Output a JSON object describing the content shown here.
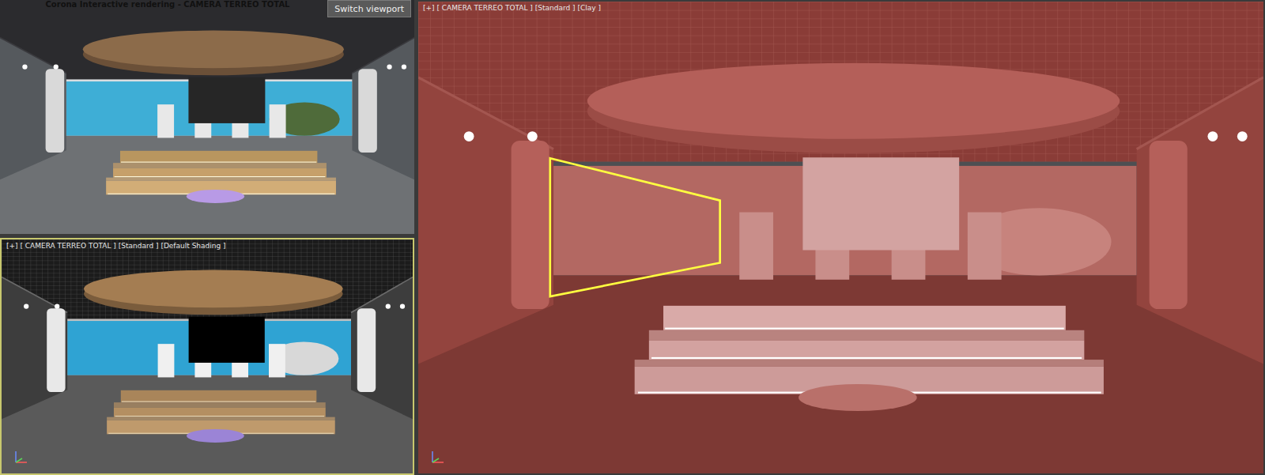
{
  "render_window": {
    "title": "Corona Interactive rendering - CAMERA TERREO TOTAL",
    "button": "Switch viewport"
  },
  "viewports": [
    {
      "label": "[+] [ CAMERA TERREO TOTAL ] [Standard ] [Default Shading ]",
      "shading": "default",
      "selected": true,
      "shows_selection": false
    },
    {
      "label": "[+] [ CAMERA TERREO TOTAL ] [Standard ] [Clay ]",
      "shading": "clay",
      "selected": false,
      "shows_selection": true
    }
  ]
}
